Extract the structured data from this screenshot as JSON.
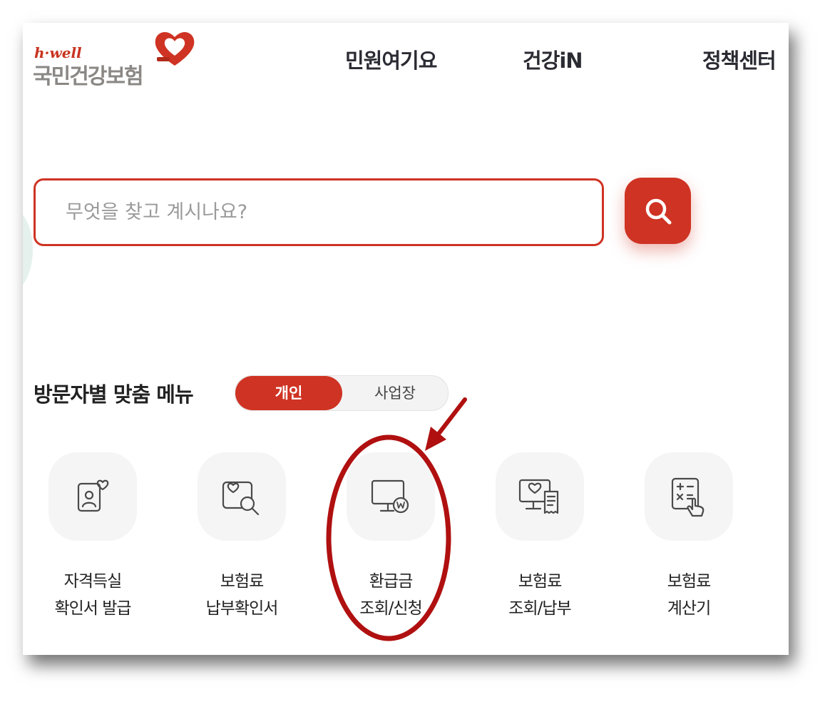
{
  "header": {
    "logo_tagline": "h·well",
    "logo_name": "국민건강보험",
    "nav": [
      {
        "label": "민원여기요"
      },
      {
        "label": "건강iN"
      },
      {
        "label": "정책센터"
      }
    ]
  },
  "search": {
    "placeholder": "무엇을 찾고 계시나요?",
    "value": "",
    "button_icon": "search-icon"
  },
  "visitor_menu": {
    "title": "방문자별 맞춤 메뉴",
    "toggle": {
      "options": [
        "개인",
        "사업장"
      ],
      "selected": "개인"
    },
    "items": [
      {
        "line1": "자격득실",
        "line2": "확인서 발급",
        "icon": "id-card-heart-icon"
      },
      {
        "line1": "보험료",
        "line2": "납부확인서",
        "icon": "photo-search-icon"
      },
      {
        "line1": "환급금",
        "line2": "조회/신청",
        "icon": "monitor-won-icon"
      },
      {
        "line1": "보험료",
        "line2": "조회/납부",
        "icon": "monitor-receipt-icon"
      },
      {
        "line1": "보험료",
        "line2": "계산기",
        "icon": "calculator-touch-icon"
      }
    ]
  },
  "colors": {
    "brand_red": "#cf3323",
    "annotation_red": "#b01010",
    "logo_gray": "#8a8784",
    "text_dark": "#2b2b33",
    "icon_bg": "#f5f5f5",
    "deco_mint": "#e4f1ec"
  }
}
